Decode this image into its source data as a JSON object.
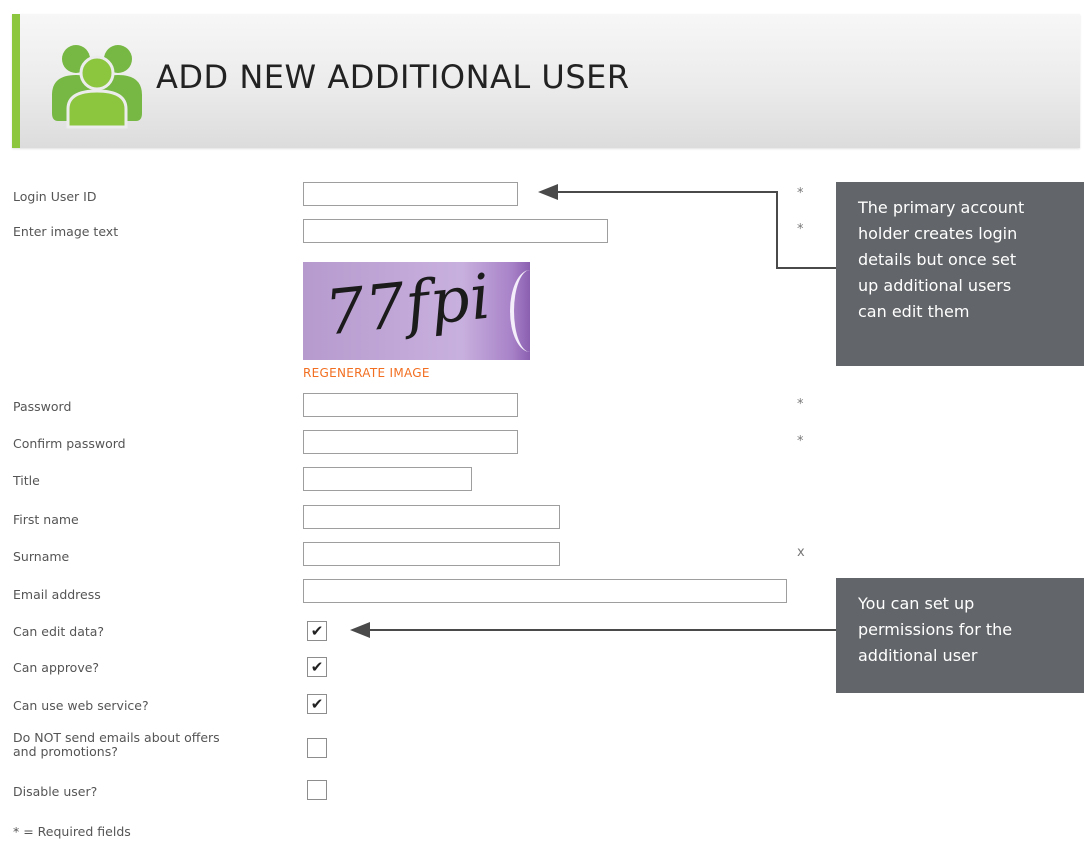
{
  "header": {
    "title": "ADD NEW ADDITIONAL USER",
    "icon": "users-group-icon",
    "accent_color": "#8cc63f"
  },
  "form": {
    "login_user_id_label": "Login User ID",
    "image_text_label": "Enter image text",
    "captcha_text": "77fpi",
    "regenerate_label": "REGENERATE IMAGE",
    "password_label": "Password",
    "confirm_password_label": "Confirm password",
    "title_label": "Title",
    "first_name_label": "First name",
    "surname_label": "Surname",
    "email_label": "Email address",
    "can_edit_label": "Can edit data?",
    "can_approve_label": "Can approve?",
    "can_use_web_service_label": "Can use web service?",
    "no_emails_label_line1": "Do NOT send emails about offers",
    "no_emails_label_line2": "and promotions?",
    "disable_user_label": "Disable user?",
    "required_marker": "*",
    "surname_marker": "x",
    "required_footnote": "* = Required fields",
    "checkboxes": {
      "can_edit": true,
      "can_approve": true,
      "can_use_web_service": true,
      "no_emails": false,
      "disable_user": false
    },
    "checkmark_glyph": "✔"
  },
  "callouts": {
    "login": {
      "line1": "The primary account",
      "line2": "holder creates login",
      "line3": "details but once set",
      "line4": "up additional users",
      "line5": "can edit them"
    },
    "permissions": {
      "line1": "You can set up",
      "line2": "permissions for the",
      "line3": "additional user"
    },
    "color": "#626569"
  }
}
